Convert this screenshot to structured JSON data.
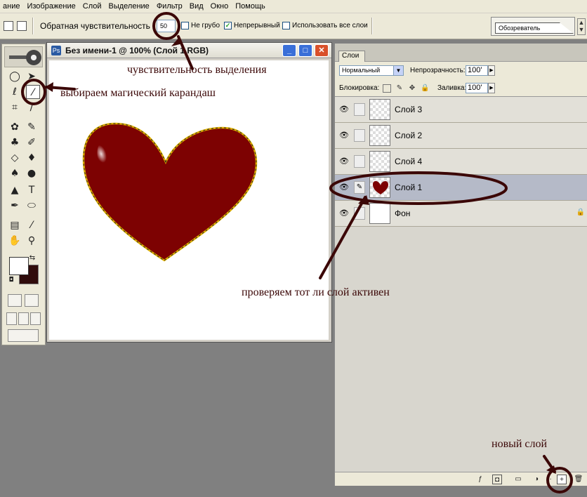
{
  "menu": [
    "ание",
    "Изображение",
    "Слой",
    "Выделение",
    "Фильтр",
    "Вид",
    "Окно",
    "Помощь"
  ],
  "options": {
    "tolerance_label": "Обратная чувствительность",
    "tolerance_value": "50",
    "anti_alias_label": "Не грубо",
    "contiguous_label": "Непрерывный",
    "all_layers_label": "Использовать все слои",
    "browser_tab": "Обозреватель",
    "checkbox_checked_glyph": "✓"
  },
  "document": {
    "title": "Без имени-1 @ 100% (Слой 1,RGB)",
    "heart_color": "#7d0202",
    "selection_color": "#e0b000"
  },
  "layers_panel": {
    "tab": "Слои",
    "blend_mode": "Нормальный",
    "opacity_label": "Непрозрачность:",
    "opacity_value": "100'",
    "lock_label": "Блокировка:",
    "fill_label": "Заливка:",
    "fill_value": "100'",
    "layers": [
      {
        "name": "Слой 3"
      },
      {
        "name": "Слой 2"
      },
      {
        "name": "Слой 4"
      },
      {
        "name": "Слой 1"
      },
      {
        "name": "Фон"
      }
    ]
  },
  "annotations": {
    "tolerance": "чувствительность выделения",
    "magic_wand": "выбираем магический карандаш",
    "check_layer": "проверяем тот ли слой активен",
    "new_layer": "новый слой",
    "color": "#3b0707"
  }
}
